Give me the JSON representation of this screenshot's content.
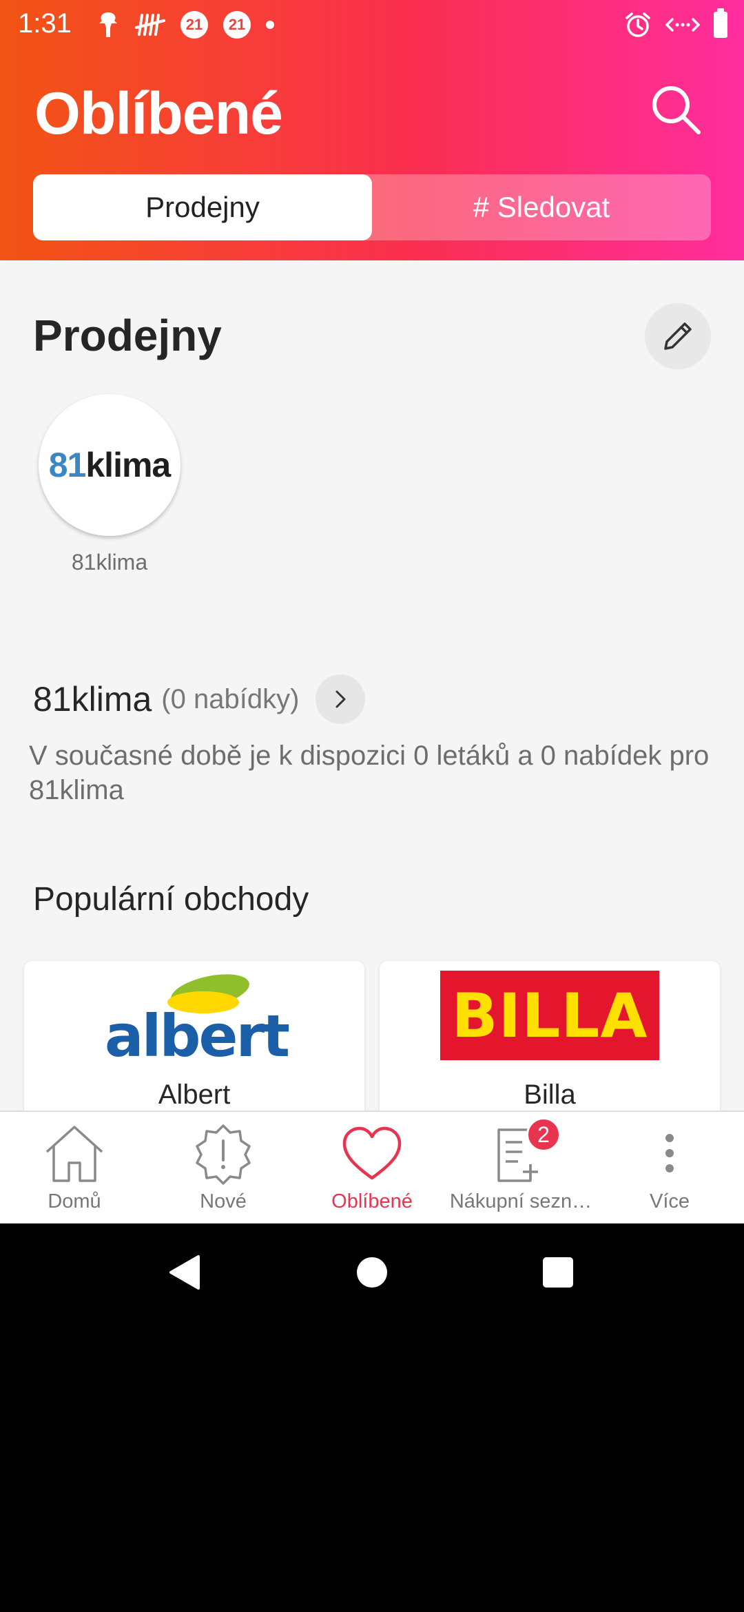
{
  "status_bar": {
    "time": "1:31",
    "left_badges": [
      "21",
      "21"
    ]
  },
  "header": {
    "title": "Oblíbené",
    "tabs": [
      {
        "label": "Prodejny",
        "active": true
      },
      {
        "label": "# Sledovat",
        "active": false
      }
    ]
  },
  "stores_section": {
    "title": "Prodejny",
    "stores": [
      {
        "logo_number": "81",
        "logo_text": "klima",
        "label": "81klima"
      }
    ]
  },
  "offers": {
    "store_name": "81klima",
    "count_text": "(0 nabídky)",
    "description": "V současné době je k dispozici 0 letáků a 0 nabídek pro 81klima"
  },
  "popular": {
    "title": "Populární obchody",
    "shops": [
      {
        "name": "Albert",
        "logo_text": "albert"
      },
      {
        "name": "Billa",
        "logo_text": "BILLA"
      }
    ]
  },
  "bottom_nav": {
    "items": [
      {
        "label": "Domů",
        "icon": "home-icon"
      },
      {
        "label": "Nové",
        "icon": "new-alert-icon"
      },
      {
        "label": "Oblíbené",
        "icon": "heart-icon",
        "active": true
      },
      {
        "label": "Nákupní sezn…",
        "icon": "shopping-list-icon",
        "badge": "2"
      },
      {
        "label": "Více",
        "icon": "more-vertical-icon"
      }
    ]
  },
  "colors": {
    "gradient_start": "#f25414",
    "gradient_end": "#ff2d9e",
    "accent": "#e8344e"
  }
}
